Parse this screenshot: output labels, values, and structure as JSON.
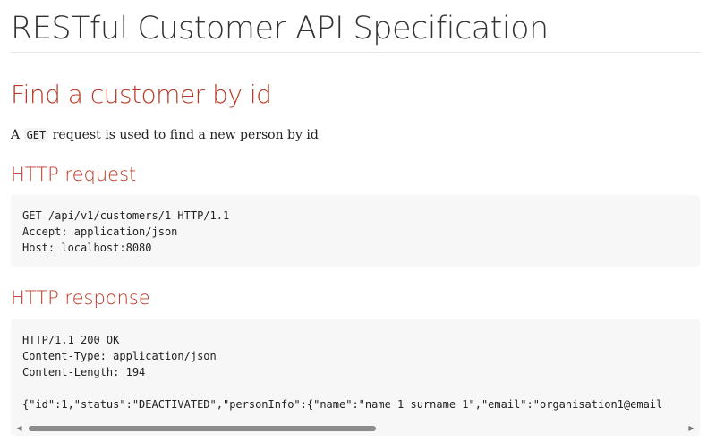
{
  "document": {
    "title": "RESTful Customer API Specification"
  },
  "section": {
    "title": "Find a customer by id",
    "intro_prefix": "A",
    "intro_code": "GET",
    "intro_suffix": "request is used to find a new person by id"
  },
  "request": {
    "heading": "HTTP request",
    "lines": [
      "GET /api/v1/customers/1 HTTP/1.1",
      "Accept: application/json",
      "Host: localhost:8080"
    ]
  },
  "response": {
    "heading": "HTTP response",
    "lines": [
      "HTTP/1.1 200 OK",
      "Content-Type: application/json",
      "Content-Length: 194",
      "",
      "{\"id\":1,\"status\":\"DEACTIVATED\",\"personInfo\":{\"name\":\"name 1 surname 1\",\"email\":\"organisation1@email"
    ],
    "scroll_position": 0,
    "scroll_thumb_fraction": 0.5
  },
  "icons": {
    "scroll_left": "scroll-left-arrow-icon",
    "scroll_right": "scroll-right-arrow-icon"
  },
  "colors": {
    "heading_accent": "#ba3925",
    "code_background": "#f7f7f8"
  }
}
